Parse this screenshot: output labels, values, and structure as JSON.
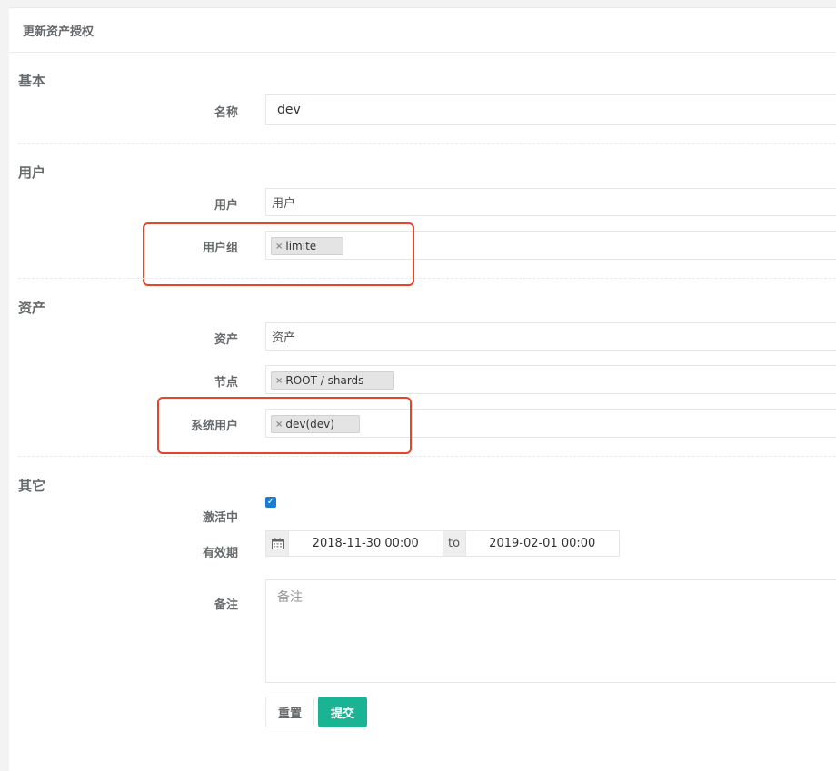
{
  "panel": {
    "title": "更新资产授权"
  },
  "sections": {
    "basic": "基本",
    "user": "用户",
    "asset": "资产",
    "other": "其它"
  },
  "form": {
    "name": {
      "label": "名称",
      "value": "dev"
    },
    "users": {
      "label": "用户",
      "placeholder": "用户"
    },
    "user_groups": {
      "label": "用户组",
      "tags": [
        "limite"
      ]
    },
    "assets": {
      "label": "资产",
      "placeholder": "资产"
    },
    "nodes": {
      "label": "节点",
      "tags": [
        "ROOT / shards"
      ]
    },
    "system_users": {
      "label": "系统用户",
      "tags": [
        "dev(dev)"
      ]
    },
    "is_active": {
      "label": "激活中",
      "checked": true
    },
    "validity": {
      "label": "有效期",
      "start": "2018-11-30 00:00",
      "separator": "to",
      "end": "2019-02-01 00:00"
    },
    "comment": {
      "label": "备注",
      "placeholder": "备注"
    }
  },
  "buttons": {
    "reset": "重置",
    "submit": "提交"
  },
  "colors": {
    "highlight": "#e8442a",
    "primary": "#1ab394",
    "checkbox": "#1a7bd6"
  },
  "icons": {
    "tag_remove": "close-icon",
    "date": "calendar-icon",
    "check": "check-icon"
  }
}
